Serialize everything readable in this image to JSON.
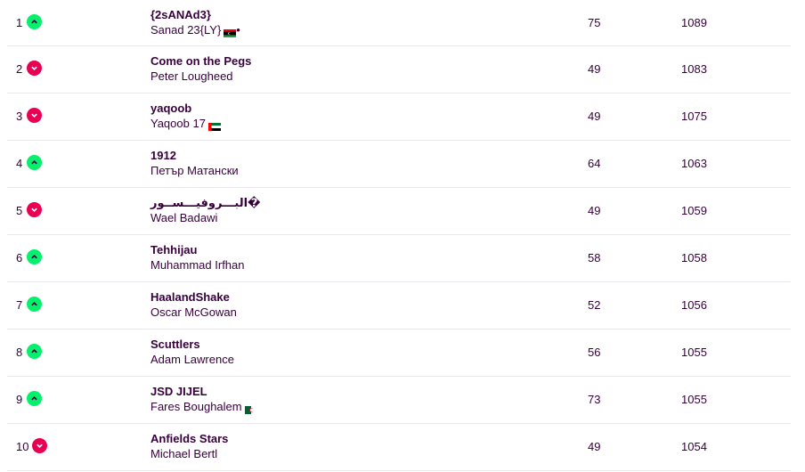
{
  "standings": [
    {
      "rank": "1",
      "movement": "up",
      "team": "{2sANAd3}",
      "manager": "Sanad 23{LY}",
      "flag": "ly",
      "suffix": "•",
      "gw": "75",
      "total": "1089"
    },
    {
      "rank": "2",
      "movement": "down",
      "team": "Come on the Pegs",
      "manager": "Peter Lougheed",
      "flag": "",
      "suffix": "",
      "gw": "49",
      "total": "1083"
    },
    {
      "rank": "3",
      "movement": "down",
      "team": "yaqoob",
      "manager": "Yaqoob 17",
      "flag": "ae",
      "suffix": "",
      "gw": "49",
      "total": "1075"
    },
    {
      "rank": "4",
      "movement": "up",
      "team": "1912",
      "manager": "Петър Матански",
      "flag": "",
      "suffix": "",
      "gw": "64",
      "total": "1063"
    },
    {
      "rank": "5",
      "movement": "down",
      "team": "البـــروفيـــســور�",
      "manager": "Wael Badawi",
      "flag": "",
      "suffix": "",
      "gw": "49",
      "total": "1059"
    },
    {
      "rank": "6",
      "movement": "up",
      "team": "Tehhijau",
      "manager": "Muhammad Irfhan",
      "flag": "",
      "suffix": "",
      "gw": "58",
      "total": "1058"
    },
    {
      "rank": "7",
      "movement": "up",
      "team": "HaalandShake",
      "manager": "Oscar McGowan",
      "flag": "",
      "suffix": "",
      "gw": "52",
      "total": "1056"
    },
    {
      "rank": "8",
      "movement": "up",
      "team": "Scuttlers",
      "manager": "Adam Lawrence",
      "flag": "",
      "suffix": "",
      "gw": "56",
      "total": "1055"
    },
    {
      "rank": "9",
      "movement": "up",
      "team": "JSD JIJEL",
      "manager": "Fares Boughalem",
      "flag": "dz",
      "suffix": "",
      "gw": "73",
      "total": "1055"
    },
    {
      "rank": "10",
      "movement": "down",
      "team": "Anfields Stars",
      "manager": "Michael Bertl",
      "flag": "",
      "suffix": "",
      "gw": "49",
      "total": "1054"
    }
  ],
  "colors": {
    "up": "#05f06c",
    "down": "#e90052",
    "text": "#37003c"
  }
}
